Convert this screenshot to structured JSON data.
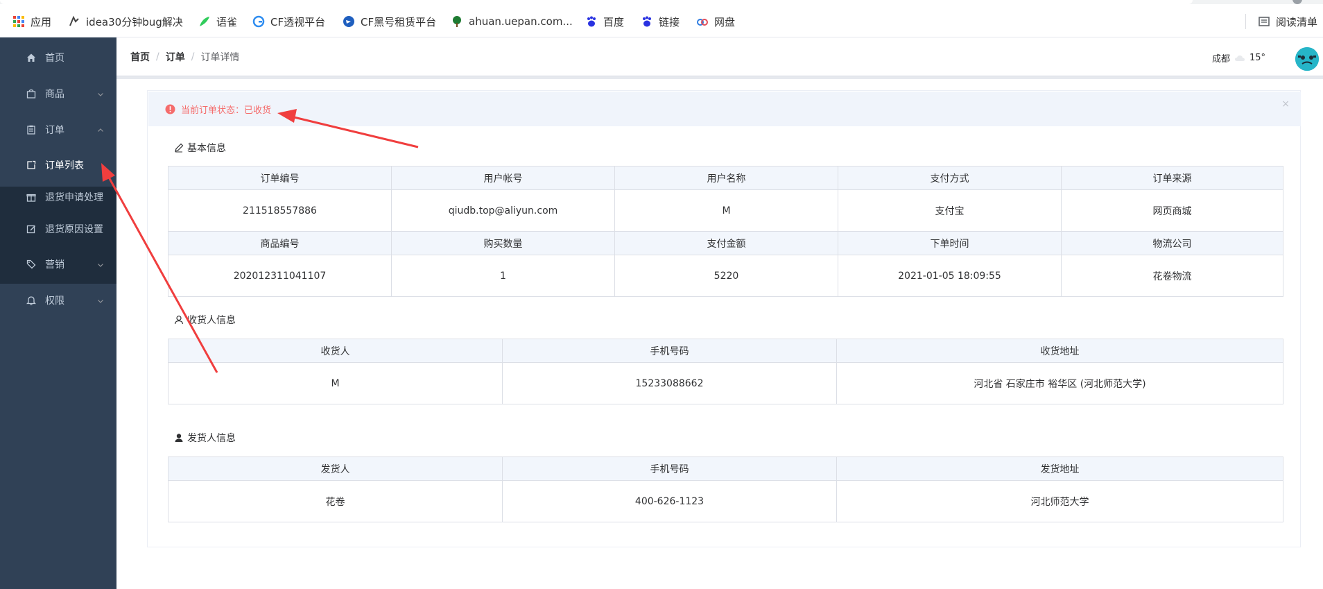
{
  "bookmarks": [
    {
      "label": "应用",
      "icon": "apps-grid-icon"
    },
    {
      "label": "idea30分钟bug解决",
      "icon": "bookmark-logo-icon"
    },
    {
      "label": "语雀",
      "icon": "yuque-icon"
    },
    {
      "label": "CF透视平台",
      "icon": "cf-logo-icon"
    },
    {
      "label": "CF黑号租赁平台",
      "icon": "bird-icon"
    },
    {
      "label": "ahuan.uepan.com...",
      "icon": "tree-icon"
    },
    {
      "label": "百度",
      "icon": "baidu-paw-icon"
    },
    {
      "label": "链接",
      "icon": "baidu-paw-icon"
    },
    {
      "label": "网盘",
      "icon": "cloud-drive-icon"
    }
  ],
  "reading_list": {
    "label": "阅读清单",
    "icon": "reading-list-icon"
  },
  "sidebar": {
    "items": [
      {
        "label": "首页",
        "icon": "home-icon"
      },
      {
        "label": "商品",
        "icon": "shopping-bag-icon"
      },
      {
        "label": "订单",
        "icon": "clipboard-icon"
      },
      {
        "label": "营销",
        "icon": "tag-icon"
      },
      {
        "label": "权限",
        "icon": "bell-icon"
      }
    ],
    "sub_items": [
      {
        "label": "订单列表",
        "icon": "external-icon"
      },
      {
        "label": "退货申请处理",
        "icon": "gift-icon"
      },
      {
        "label": "退货原因设置",
        "icon": "edit-icon"
      }
    ]
  },
  "breadcrumb": [
    "首页",
    "订单",
    "订单详情"
  ],
  "weather": {
    "city": "成都",
    "temp": "15°"
  },
  "alert": {
    "text": "当前订单状态：已收货",
    "color": "#f56c6c"
  },
  "basic_info": {
    "title": "基本信息",
    "headers1": [
      "订单编号",
      "用户帐号",
      "用户名称",
      "支付方式",
      "订单来源"
    ],
    "values1": [
      "211518557886",
      "qiudb.top@aliyun.com",
      "M",
      "支付宝",
      "网页商城"
    ],
    "headers2": [
      "商品编号",
      "购买数量",
      "支付金额",
      "下单时间",
      "物流公司"
    ],
    "values2": [
      "202012311041107",
      "1",
      "5220",
      "2021-01-05 18:09:55",
      "花卷物流"
    ]
  },
  "receiver_info": {
    "title": "收货人信息",
    "headers": [
      "收货人",
      "手机号码",
      "收货地址"
    ],
    "values": [
      "M",
      "15233088662",
      "河北省 石家庄市 裕华区 (河北师范大学)"
    ]
  },
  "sender_info": {
    "title": "发货人信息",
    "headers": [
      "发货人",
      "手机号码",
      "发货地址"
    ],
    "values": [
      "花卷",
      "400-626-1123",
      "河北师范大学"
    ]
  },
  "colors": {
    "sidebar_bg": "#304156",
    "submenu_bg": "#1f2d3d",
    "header_cell": "#f2f6fc",
    "arrow": "#f03e3e"
  }
}
